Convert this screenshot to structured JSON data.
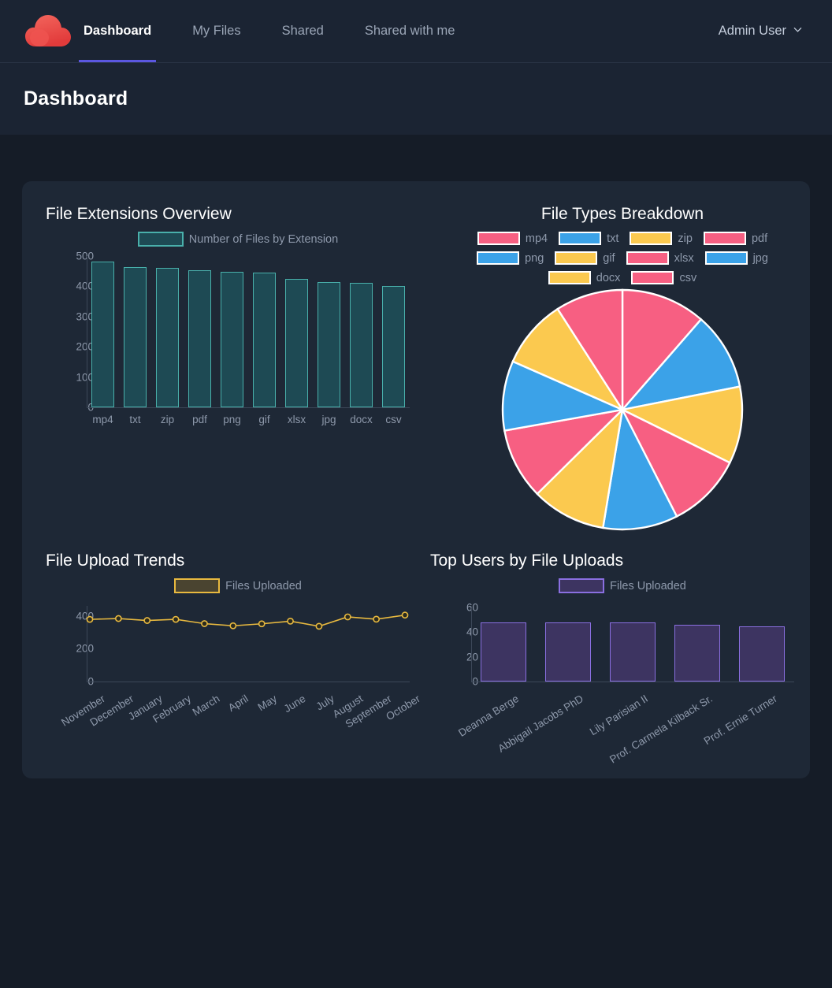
{
  "app": {
    "logo_icon": "cloud-icon",
    "logo_color": "#ef4a4a"
  },
  "nav": {
    "items": [
      {
        "label": "Dashboard",
        "active": true
      },
      {
        "label": "My Files",
        "active": false
      },
      {
        "label": "Shared",
        "active": false
      },
      {
        "label": "Shared with me",
        "active": false
      }
    ],
    "user": {
      "name": "Admin User",
      "caret_icon": "chevron-down-icon"
    },
    "active_underline_color": "#5b57e0"
  },
  "page": {
    "title": "Dashboard"
  },
  "panels": {
    "extensions": {
      "title": "File Extensions Overview"
    },
    "types": {
      "title": "File Types Breakdown"
    },
    "trends": {
      "title": "File Upload Trends"
    },
    "users": {
      "title": "Top Users by File Uploads"
    }
  },
  "chart_data": [
    {
      "id": "file-extensions-overview",
      "type": "bar",
      "title": "File Extensions Overview",
      "legend": [
        {
          "name": "Number of Files by Extension",
          "fill": "#1e4a54",
          "border": "#49b0ab"
        }
      ],
      "legend_position": "top-center",
      "categories": [
        "mp4",
        "txt",
        "zip",
        "pdf",
        "png",
        "gif",
        "xlsx",
        "jpg",
        "docx",
        "csv"
      ],
      "values": [
        481,
        463,
        460,
        453,
        448,
        446,
        424,
        413,
        411,
        400
      ],
      "xlabel": "",
      "ylabel": "",
      "ylim": [
        0,
        500
      ],
      "yticks": [
        0,
        100,
        200,
        300,
        400,
        500
      ],
      "grid": false
    },
    {
      "id": "file-types-breakdown",
      "type": "pie",
      "title": "File Types Breakdown",
      "legend_position": "top-center",
      "labels": [
        "mp4",
        "txt",
        "zip",
        "pdf",
        "png",
        "gif",
        "xlsx",
        "jpg",
        "docx",
        "csv"
      ],
      "values": [
        11.4,
        10.5,
        10.4,
        10.2,
        10.1,
        10.0,
        9.6,
        9.4,
        9.3,
        9.1
      ],
      "colors": [
        "#f75f82",
        "#3ba2e8",
        "#fbc94f",
        "#f75f82",
        "#3ba2e8",
        "#fbc94f",
        "#f75f82",
        "#3ba2e8",
        "#fbc94f",
        "#f75f82"
      ],
      "slice_border": "#ffffff"
    },
    {
      "id": "file-upload-trends",
      "type": "line",
      "title": "File Upload Trends",
      "legend": [
        {
          "name": "Files Uploaded",
          "fill": "#4a4430",
          "border": "#e8b93f"
        }
      ],
      "legend_position": "top-center",
      "categories": [
        "November",
        "December",
        "January",
        "February",
        "March",
        "April",
        "May",
        "June",
        "July",
        "August",
        "September",
        "October"
      ],
      "values": [
        378,
        383,
        371,
        378,
        352,
        339,
        351,
        367,
        336,
        393,
        379,
        404
      ],
      "xlabel": "",
      "ylabel": "",
      "ylim": [
        0,
        460
      ],
      "yticks": [
        0,
        200,
        400
      ],
      "line_color": "#e8b93f",
      "marker": "circle",
      "grid": false
    },
    {
      "id": "top-users-by-file-uploads",
      "type": "bar",
      "title": "Top Users by File Uploads",
      "legend": [
        {
          "name": "Files Uploaded",
          "fill": "#3d3461",
          "border": "#8a6fe0"
        }
      ],
      "legend_position": "top-center",
      "categories": [
        "Deanna Berge",
        "Abbigail Jacobs PhD",
        "Lily Parisian II",
        "Prof. Carmela Kilback Sr.",
        "Prof. Ernie Turner"
      ],
      "values": [
        48,
        48,
        48,
        46,
        45
      ],
      "xlabel": "",
      "ylabel": "",
      "ylim": [
        0,
        60
      ],
      "yticks": [
        0,
        20,
        40,
        60
      ],
      "grid": false
    }
  ]
}
